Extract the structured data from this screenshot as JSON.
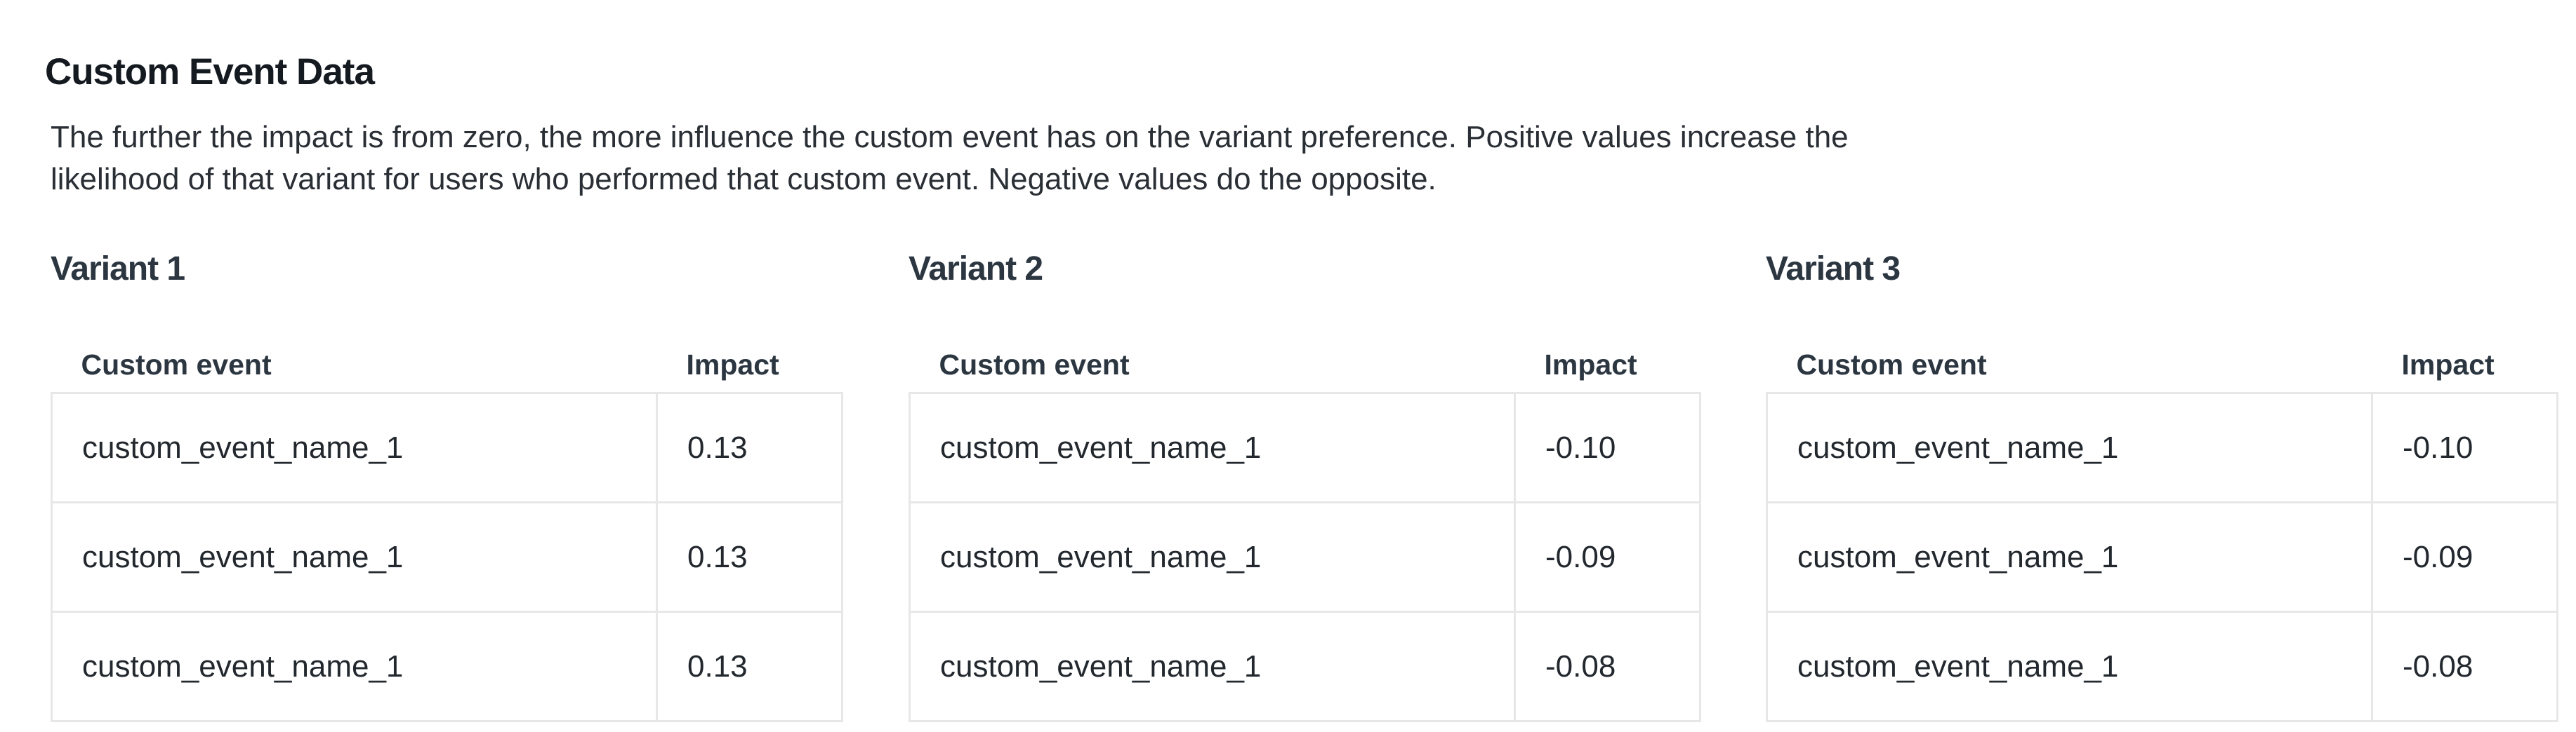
{
  "section": {
    "title": "Custom Event Data",
    "description": "The further the impact is from zero, the more influence the custom event has on the variant preference. Positive values increase the likelihood of that variant for users who performed that custom event. Negative values do the opposite."
  },
  "variants": [
    {
      "title": "Variant 1",
      "columns": [
        "Custom event",
        "Impact"
      ],
      "rows": [
        {
          "event": "custom_event_name_1",
          "impact": "0.13"
        },
        {
          "event": "custom_event_name_1",
          "impact": "0.13"
        },
        {
          "event": "custom_event_name_1",
          "impact": "0.13"
        }
      ]
    },
    {
      "title": "Variant 2",
      "columns": [
        "Custom event",
        "Impact"
      ],
      "rows": [
        {
          "event": "custom_event_name_1",
          "impact": "-0.10"
        },
        {
          "event": "custom_event_name_1",
          "impact": "-0.09"
        },
        {
          "event": "custom_event_name_1",
          "impact": "-0.08"
        }
      ]
    },
    {
      "title": "Variant 3",
      "columns": [
        "Custom event",
        "Impact"
      ],
      "rows": [
        {
          "event": "custom_event_name_1",
          "impact": "-0.10"
        },
        {
          "event": "custom_event_name_1",
          "impact": "-0.09"
        },
        {
          "event": "custom_event_name_1",
          "impact": "-0.08"
        }
      ]
    }
  ]
}
